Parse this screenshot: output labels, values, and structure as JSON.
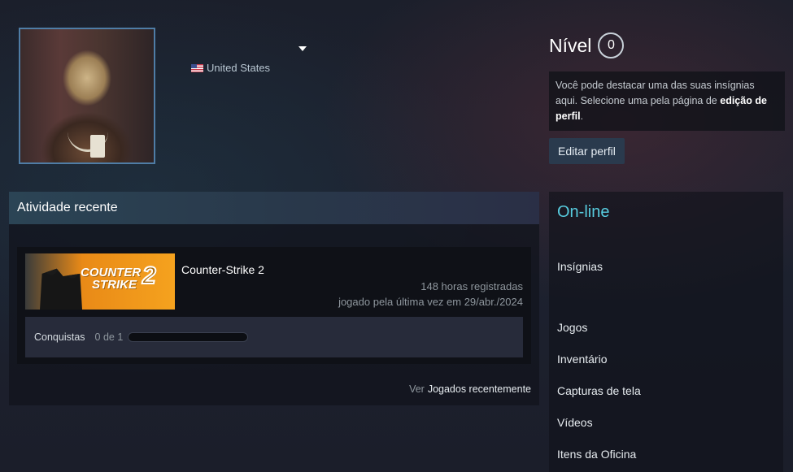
{
  "profile": {
    "persona_name": "",
    "location": "United States",
    "flag_icon": "us-flag-icon",
    "avatar_icon": "avatar-image"
  },
  "level": {
    "label": "Nível",
    "value": "0"
  },
  "badge_info": {
    "text_part1": "Você pode destacar uma das suas insígnias aqui. Selecione uma pela página de",
    "text_bold": "edição de perfil",
    "text_end": "."
  },
  "edit_profile_button": "Editar perfil",
  "side_panel": {
    "status": "On-line",
    "links": [
      "Insígnias",
      "Jogos",
      "Inventário",
      "Capturas de tela",
      "Vídeos",
      "Itens da Oficina"
    ]
  },
  "recent_activity": {
    "header": "Atividade recente",
    "game": {
      "name": "Counter-Strike 2",
      "capsule_logo_line1": "COUNTER",
      "capsule_logo_line2": "STRIKE",
      "capsule_logo_num": "2",
      "hours": "148 horas registradas",
      "last_played": "jogado pela última vez em 29/abr./2024",
      "achievements_label": "Conquistas",
      "achievements_count": "0 de 1",
      "achievements_progress": 0
    },
    "view_prefix": "Ver",
    "view_link": "Jogados recentemente"
  },
  "colors": {
    "accent_online": "#57cbde",
    "avatar_border": "#4f7da6",
    "button_bg": "#2a3a4d",
    "capsule_orange": "#f5a21e"
  }
}
